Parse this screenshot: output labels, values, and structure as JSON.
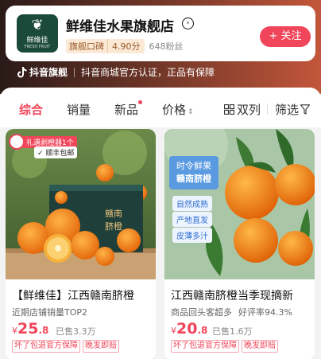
{
  "shop": {
    "logo_text": "鲜维佳",
    "logo_sub": "FRESH FRUIT",
    "name": "鲜维佳水果旗舰店",
    "rating_label": "旗舰口碑",
    "rating_score": "4.90分",
    "fans": "648粉丝",
    "follow_label": "+ 关注"
  },
  "official": {
    "brand": "抖音旗舰",
    "text": "抖音商城官方认证，正品有保障"
  },
  "sort": {
    "items": [
      "综合",
      "销量",
      "新品",
      "价格"
    ],
    "layout_label": "双列",
    "filter_label": "筛选"
  },
  "products": [
    {
      "title": "【鲜维佳】江西赣南脐橙",
      "subtitle": "近期店铺销量TOP2",
      "subtitle_extra": "",
      "price_symbol": "¥",
      "price_int": "25",
      "price_dec": ".8",
      "sold": "已售3.3万",
      "tags": [
        "坏了包退官方保障",
        "晚发即赔"
      ],
      "badge1": "礼遇剥橙器1个",
      "badge2": "顺丰包邮",
      "box_text": "赣南脐橙"
    },
    {
      "title": "江西赣南脐橙当季现摘新",
      "subtitle": "商品回头客超多",
      "subtitle_extra": "好评率94.3%",
      "price_symbol": "¥",
      "price_int": "20",
      "price_dec": ".8",
      "sold": "已售1.6万",
      "tags": [
        "坏了包退官方保障",
        "晚发即赔"
      ],
      "banner_title": "时令鲜果",
      "banner_sub": "赣南脐橙",
      "features": [
        "自然成熟",
        "产地直发",
        "皮薄多汁"
      ]
    }
  ],
  "colors": {
    "accent": "#f0455a",
    "logo_bg": "#1c4a3a"
  }
}
